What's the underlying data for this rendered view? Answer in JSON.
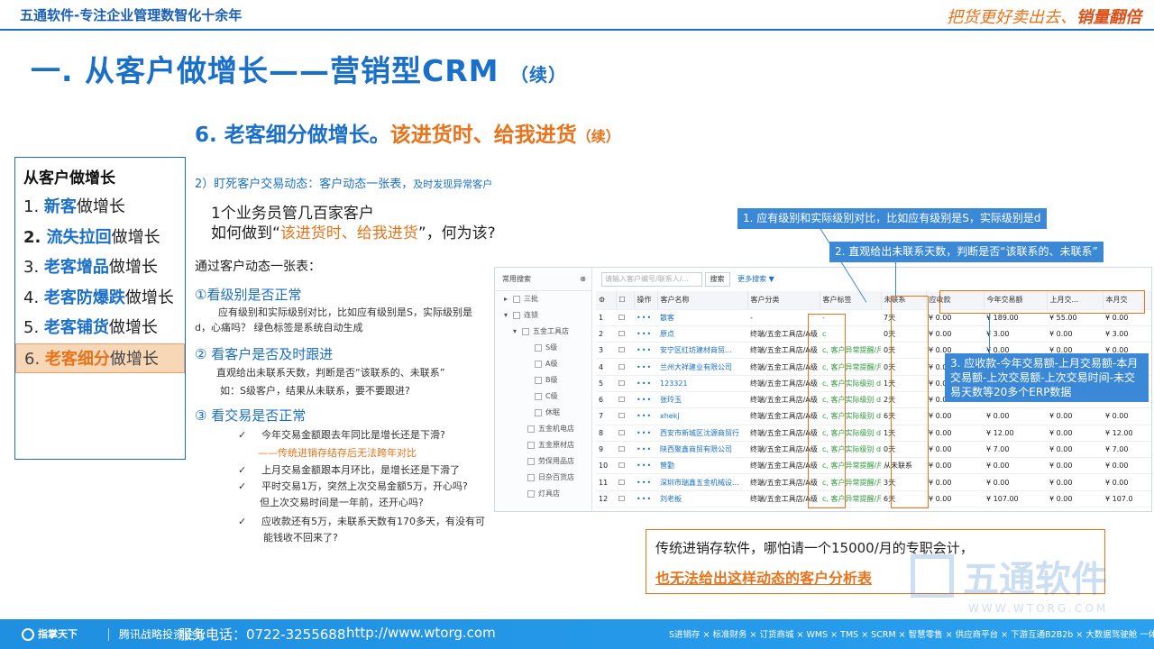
{
  "header": {
    "brand_line": "五通软件-专注企业管理数智化十余年",
    "slogan_main": "把货更好卖出去、",
    "slogan_bold": "销量翻倍"
  },
  "title": {
    "main": "一. 从客户做增长——营销型CRM",
    "suffix": "（续）"
  },
  "subtitle": {
    "prefix": "6. 老客细分做增长。",
    "highlight": "该进货时、给我进货",
    "suffix": "（续）"
  },
  "nav": {
    "head": "从客户做增长",
    "items": [
      {
        "num": "1. ",
        "key": "新客",
        "rest": "做增长"
      },
      {
        "num": "2. ",
        "key": "流失拉回",
        "rest": "做增长"
      },
      {
        "num": "3. ",
        "key": "老客增品",
        "rest": "做增长"
      },
      {
        "num": "4. ",
        "key": "老客防爆跌",
        "rest": "做增长"
      },
      {
        "num": "5. ",
        "key": "老客铺货",
        "rest": "做增长"
      },
      {
        "num": "6. ",
        "key": "老客细分",
        "rest": "做增长"
      }
    ]
  },
  "content": {
    "point2": "2）盯死客户交易动态：客户动态一张表，",
    "point2_small": "及时发现异常客户",
    "line1": "1个业务员管几百家客户",
    "line2_a": "如何做到“",
    "line2_b": "该进货时、给我进货",
    "line2_c": "”，何为该?",
    "via": "通过客户动态一张表：",
    "s1_title": "①看级别是否正常",
    "s1_note": "应有级别和实际级别对比，比如应有级别是S，实际级别是d，心痛吗？ 绿色标签是系统自动生成",
    "s2_title": "② 看客户是否及时跟进",
    "s2_note1": "直观给出未联系天数，判断是否“该联系的、未联系”",
    "s2_note2": "如：S级客户，结果从未联系，要不要跟进?",
    "s3_title": "③ 看交易是否正常",
    "check1": "今年交易金额跟去年同比是增长还是下滑?",
    "check1_sub": "——传统进销存结存后无法跨年对比",
    "check2": "上月交易金额跟本月环比，是增长还是下滑了",
    "check3a": "平时交易1万，突然上次交易金额5万，开心吗?",
    "check3b": "但上次交易时间是一年前，还开心吗?",
    "check4a": "应收款还有5万，未联系天数有170多天，有没有可",
    "check4b": "能钱收不回来了?"
  },
  "crm": {
    "tree_header": "常用搜索",
    "tree_close": "⊗",
    "tree_nodes": [
      "三批",
      "连锁",
      "五金工具店",
      "S级",
      "A级",
      "B级",
      "C级",
      "休眠",
      "五金机电店",
      "五金原材店",
      "劳保用品店",
      "日杂百货店",
      "灯具店"
    ],
    "search_placeholder": "请输入客户编号/联系人/...",
    "search_button": "搜索",
    "more_filter": "更多搜索 ▼",
    "columns": [
      "",
      "",
      "操作",
      "客户名称",
      "客户分类",
      "客户标签",
      "未联系",
      "应收款",
      "今年交易额",
      "上月交...",
      "本月交"
    ],
    "rows": [
      {
        "n": "1",
        "name": "散客",
        "cat": "-",
        "tag": "-",
        "days": "7天",
        "ar": "¥ 0.00",
        "year": "¥ 189.00",
        "lm": "¥ 55.00",
        "tm": "¥ 0.00"
      },
      {
        "n": "2",
        "name": "原点",
        "cat": "终端/五金工具店/A级",
        "tag": "c",
        "days": "0天",
        "ar": "¥ 0.00",
        "year": "¥ 3.00",
        "lm": "¥ 0.00",
        "tm": "¥ 3.00"
      },
      {
        "n": "3",
        "name": "安宁区红坊建材商贸...",
        "cat": "终端/五金工具店/A级",
        "tag": "c, 客户异常提醒/月...",
        "days": "0天",
        "ar": "¥ 0.00",
        "year": "¥ 0.00",
        "lm": "¥ 0.00",
        "tm": "¥ 0.00"
      },
      {
        "n": "4",
        "name": "兰州大祥建业有限公司",
        "cat": "终端/五金工具店/A级",
        "tag": "c, 客户异常提醒/月...",
        "days": "0天",
        "ar": "¥ 0.00",
        "year": "¥ 0.00",
        "lm": "¥ 0.00",
        "tm": "¥ 0.00"
      },
      {
        "n": "5",
        "name": "123321",
        "cat": "终端/五金工具店/A级",
        "tag": "c, 客户实际级别 d, 4",
        "days": "1天",
        "ar": "¥ 0.00",
        "year": "¥ 0.00",
        "lm": "¥ 0.00",
        "tm": "¥ 0.00"
      },
      {
        "n": "6",
        "name": "张玲玉",
        "cat": "终端/五金工具店/A级",
        "tag": "c, 客户实际级别 d, 4",
        "days": "2天",
        "ar": "¥ 0.00",
        "year": "¥ 0.00",
        "lm": "¥ 0.00",
        "tm": "¥ 0.00"
      },
      {
        "n": "7",
        "name": "xhekj",
        "cat": "终端/五金工具店/A级",
        "tag": "c, 客户实际级别 d, 4",
        "days": "6天",
        "ar": "¥ 0.00",
        "year": "¥ 0.00",
        "lm": "¥ 0.00",
        "tm": "¥ 0.00"
      },
      {
        "n": "8",
        "name": "西安市新城区沈源商贸行",
        "cat": "终端/五金工具店/A级",
        "tag": "c, 客户实际级别 d, 4",
        "days": "1天",
        "ar": "¥ 0.00",
        "year": "¥ 12.00",
        "lm": "¥ 0.00",
        "tm": "¥ 12.00"
      },
      {
        "n": "9",
        "name": "陕西聚鑫商贸有限公司",
        "cat": "终端/五金工具店/A级",
        "tag": "c, 客户实际级别 d, 4",
        "days": "0天",
        "ar": "¥ 0.00",
        "year": "¥ 7.00",
        "lm": "¥ 0.00",
        "tm": "¥ 7.00"
      },
      {
        "n": "10",
        "name": "曾勤",
        "cat": "终端/五金工具店/A级",
        "tag": "c, 客户异常提醒/月...",
        "days": "从未联系",
        "ar": "¥ 0.00",
        "year": "¥ 0.00",
        "lm": "¥ 0.00",
        "tm": "¥ 0.00"
      },
      {
        "n": "11",
        "name": "深圳市瑞鑫五金机械设...",
        "cat": "终端/五金工具店/A级",
        "tag": "c, 客户异常提醒/月...",
        "days": "3天",
        "ar": "¥ 0.00",
        "year": "¥ 0.00",
        "lm": "¥ 0.00",
        "tm": "¥ 0.00"
      },
      {
        "n": "12",
        "name": "刘老板",
        "cat": "终端/五金工具店/A级",
        "tag": "c, 客户异常提醒/月...",
        "days": "6天",
        "ar": "¥ 0.00",
        "year": "¥ 107.00",
        "lm": "¥ 0.00",
        "tm": "¥ 107.0"
      }
    ]
  },
  "callouts": {
    "c1": "1. 应有级别和实际级别对比，比如应有级别是S，实际级别是d",
    "c2": "2. 直观给出未联系天数，判断是否“该联系的、未联系”",
    "c3": "3. 应收款-今年交易额-上月交易额-本月交易额-上次交易额-上次交易时间-未交易天数等20多个ERP数据"
  },
  "bottom_note": {
    "line1": "传统进销存软件，哪怕请一个15000/月的专职会计，",
    "line2": "也无法给出这样动态的客户分析表"
  },
  "watermark": {
    "name": "五通软件",
    "url": "WWW.WTORG.COM"
  },
  "footer": {
    "logo": "指掌天下",
    "tag": "腾讯战略投资企业",
    "phone": "服务电话：0722-3255688",
    "url": "http://www.wtorg.com",
    "products": "S进销存 × 标准财务 × 订货商城 × WMS × TMS × SCRM × 智慧零售 × 供应商平台 × 下游互通B2B2b × 大数据驾驶舱  一体化"
  },
  "colors": {
    "primary": "#1a6fc9",
    "accent": "#e8731a",
    "callout": "#3b88d6"
  }
}
